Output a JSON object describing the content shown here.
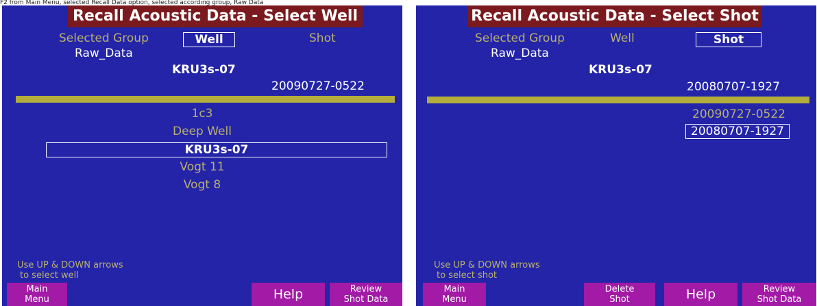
{
  "caption": "F2 from Main Menu, selected Recall Data option, selected according group, Raw Data",
  "left": {
    "title": "Recall Acoustic Data - Select Well",
    "header": {
      "selected_group_label": "Selected Group",
      "well_label": "Well",
      "shot_label": "Shot",
      "group_value": "Raw_Data",
      "well_value": "KRU3s-07",
      "shot_value": "20090727-0522"
    },
    "list": [
      "1c3",
      "Deep Well",
      "KRU3s-07",
      "Vogt 11",
      "Vogt 8"
    ],
    "selected_index": 2,
    "hint_line1": "Use UP & DOWN arrows",
    "hint_line2": "to select well",
    "keys": {
      "main_menu_1": "Main",
      "main_menu_2": "Menu",
      "help": "Help",
      "review_1": "Review",
      "review_2": "Shot Data"
    }
  },
  "right": {
    "title": "Recall Acoustic Data - Select Shot",
    "header": {
      "selected_group_label": "Selected Group",
      "well_label": "Well",
      "shot_label": "Shot",
      "group_value": "Raw_Data",
      "well_value": "KRU3s-07",
      "shot_value": "20080707-1927"
    },
    "list": [
      "20090727-0522",
      "20080707-1927"
    ],
    "selected_index": 1,
    "hint_line1": "Use UP & DOWN arrows",
    "hint_line2": "to select shot",
    "keys": {
      "main_menu_1": "Main",
      "main_menu_2": "Menu",
      "delete_1": "Delete",
      "delete_2": "Shot",
      "help": "Help",
      "review_1": "Review",
      "review_2": "Shot Data"
    }
  },
  "colors": {
    "background": "#2424a8",
    "title_bar": "#7a1a1e",
    "separator": "#b3ad3c",
    "dim_text": "#b8b070",
    "function_key": "#a21aa6"
  }
}
